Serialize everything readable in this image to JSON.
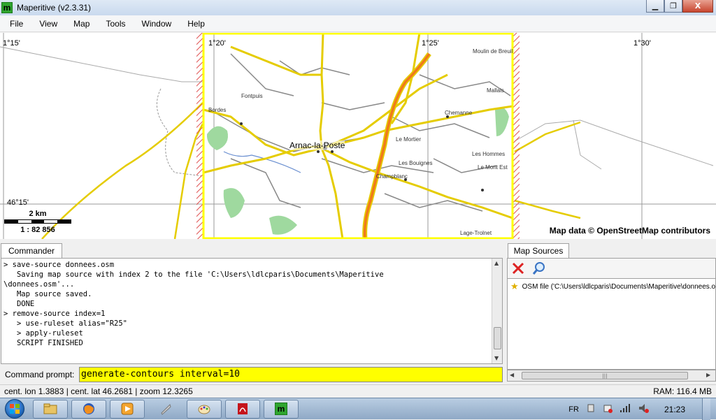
{
  "window": {
    "title": "Maperitive (v2.3.31)",
    "app_icon_letter": "m",
    "minimize": "▁",
    "maximize": "❐",
    "close": "X"
  },
  "menu": [
    "File",
    "View",
    "Map",
    "Tools",
    "Window",
    "Help"
  ],
  "map": {
    "coords": {
      "lon_left": "1°15'",
      "lon_mid1": "1°20'",
      "lon_mid2": "1°25'",
      "lon_right": "1°30'",
      "lat": "46°15'"
    },
    "scale": {
      "distance": "2 km",
      "ratio": "1 : 82 856"
    },
    "attribution": "Map data © OpenStreetMap contributors",
    "town": "Arnac-la-Poste",
    "places": [
      "Fontpuis",
      "Bordes",
      "Le Mortier",
      "Les Hommes",
      "Les Bouignes",
      "Chemanne",
      "Champblanc",
      "Le Mont Est",
      "Lage-Trolnet",
      "Mallais",
      "Moulin de Breuil"
    ]
  },
  "commander": {
    "tab": "Commander",
    "lines": [
      "> save-source donnees.osm",
      "   Saving map source with index 2 to the file 'C:\\Users\\ldlcparis\\Documents\\Maperitive",
      "\\donnees.osm'...",
      "   Map source saved.",
      "   DONE",
      "> remove-source index=1",
      "   > use-ruleset alias=\"R25\"",
      "   > apply-ruleset",
      "   SCRIPT FINISHED"
    ],
    "prompt_label": "Command prompt:",
    "prompt_value": "generate-contours interval=10"
  },
  "map_sources": {
    "tab": "Map Sources",
    "tools": [
      "remove-icon",
      "zoom-icon"
    ],
    "items": [
      {
        "label": "OSM file ('C:\\Users\\ldlcparis\\Documents\\Maperitive\\donnees.osm')"
      }
    ]
  },
  "status": {
    "left": "cent. lon 1.3883 | cent. lat 46.2681 | zoom 12.3265",
    "right": "RAM: 116.4 MB"
  },
  "taskbar": {
    "language": "FR",
    "clock": "21:23",
    "apps": [
      "explorer-icon",
      "firefox-icon",
      "media-player-icon",
      "tool-icon",
      "paint-icon",
      "pdf-icon",
      "maperitive-icon"
    ]
  },
  "colors": {
    "selection_border": "#ffff00",
    "road_yellow": "#e5cc00",
    "highway_orange": "#f07a1a",
    "prompt_bg": "#ffff00"
  }
}
